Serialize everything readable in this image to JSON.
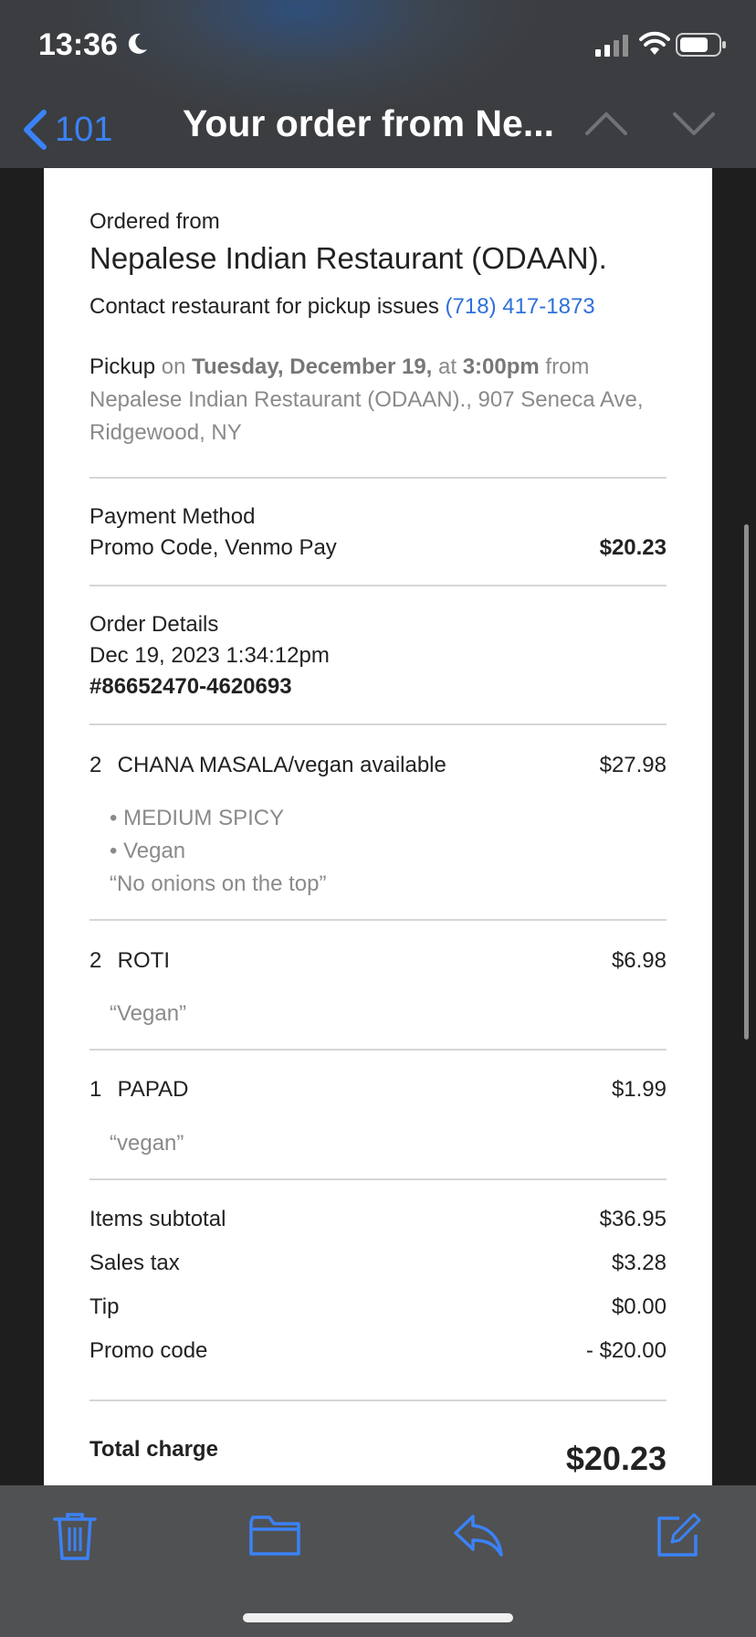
{
  "status_bar": {
    "time": "13:36"
  },
  "nav": {
    "back_count": "101",
    "title": "Your order from Ne..."
  },
  "email": {
    "ordered_from_label": "Ordered from",
    "restaurant_name": "Nepalese Indian Restaurant (ODAAN).",
    "contact_text": "Contact restaurant for pickup issues",
    "phone": "(718) 417-1873",
    "pickup": {
      "label": "Pickup",
      "on": "on",
      "date": "Tuesday, December 19,",
      "at": "at",
      "time": "3:00pm",
      "from": "from",
      "address": "Nepalese Indian Restaurant (ODAAN)., 907 Seneca Ave, Ridgewood, NY"
    },
    "payment": {
      "label": "Payment Method",
      "method": "Promo Code, Venmo Pay",
      "amount": "$20.23"
    },
    "order_details": {
      "label": "Order Details",
      "datetime": "Dec 19, 2023 1:34:12pm",
      "number": "#86652470-4620693"
    },
    "items": [
      {
        "qty": "2",
        "name": "CHANA MASALA/vegan available",
        "price": "$27.98",
        "notes": [
          "• MEDIUM SPICY",
          "• Vegan",
          "“No onions on the top”"
        ]
      },
      {
        "qty": "2",
        "name": "ROTI",
        "price": "$6.98",
        "notes": [
          "“Vegan”"
        ]
      },
      {
        "qty": "1",
        "name": "PAPAD",
        "price": "$1.99",
        "notes": [
          "“vegan”"
        ]
      }
    ],
    "totals": [
      {
        "label": "Items subtotal",
        "value": "$36.95"
      },
      {
        "label": "Sales tax",
        "value": "$3.28"
      },
      {
        "label": "Tip",
        "value": "$0.00"
      },
      {
        "label": "Promo code",
        "value": "- $20.00"
      }
    ],
    "total_charge": {
      "label": "Total charge",
      "value": "$20.23"
    }
  },
  "colors": {
    "accent": "#3b82f6",
    "link": "#2f6fdb"
  }
}
